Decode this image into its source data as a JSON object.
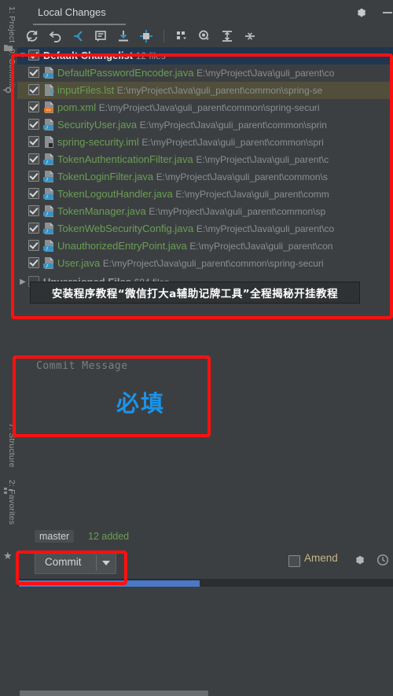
{
  "window": {
    "title": "Local Changes",
    "gear_icon": "gear-icon",
    "minimize_icon": "minimize-icon"
  },
  "rail": {
    "items": [
      {
        "label": "1: Project",
        "icon": "project-folder-icon"
      },
      {
        "label": "0: Commit",
        "icon": "commit-icon"
      },
      {
        "label": "7: Structure",
        "icon": "structure-icon"
      },
      {
        "label": "2: Favorites",
        "icon": "star-icon"
      }
    ]
  },
  "toolbar": {
    "items": [
      {
        "name": "refresh-icon",
        "title": "Refresh"
      },
      {
        "name": "rollback-icon",
        "title": "Rollback"
      },
      {
        "name": "shelve-icon",
        "title": "Shelve Silently"
      },
      {
        "name": "diff-icon",
        "title": "Show Diff"
      },
      {
        "name": "update-icon",
        "title": "Update"
      },
      {
        "name": "move-to-changelist-icon",
        "title": "Move to Another Changelist"
      },
      {
        "name": "group-by-icon",
        "title": "Group By"
      },
      {
        "name": "preview-diff-icon",
        "title": "Preview Diff"
      },
      {
        "name": "expand-all-icon",
        "title": "Expand All"
      },
      {
        "name": "collapse-all-icon",
        "title": "Collapse All"
      }
    ]
  },
  "tree": {
    "changelist": {
      "name": "Default Changelist",
      "count": "12 files",
      "checked": true,
      "expanded": true,
      "arrow": "chevron-down-icon"
    },
    "files": [
      {
        "name": "DefaultPasswordEncoder.java",
        "path": "E:\\myProject\\Java\\guli_parent\\co",
        "icon": "java-file-icon",
        "checked": true,
        "selected": false
      },
      {
        "name": "inputFiles.lst",
        "path": "E:\\myProject\\Java\\guli_parent\\common\\spring-se",
        "icon": "unknown-file-icon",
        "checked": true,
        "selected": true
      },
      {
        "name": "pom.xml",
        "path": "E:\\myProject\\Java\\guli_parent\\common\\spring-securi",
        "icon": "xml-file-icon",
        "checked": true,
        "selected": false
      },
      {
        "name": "SecurityUser.java",
        "path": "E:\\myProject\\Java\\guli_parent\\common\\sprin",
        "icon": "java-file-icon",
        "checked": true,
        "selected": false
      },
      {
        "name": "spring-security.iml",
        "path": "E:\\myProject\\Java\\guli_parent\\common\\spri",
        "icon": "iml-file-icon",
        "checked": true,
        "selected": false
      },
      {
        "name": "TokenAuthenticationFilter.java",
        "path": "E:\\myProject\\Java\\guli_parent\\c",
        "icon": "java-file-icon",
        "checked": true,
        "selected": false
      },
      {
        "name": "TokenLoginFilter.java",
        "path": "E:\\myProject\\Java\\guli_parent\\common\\s",
        "icon": "java-file-icon",
        "checked": true,
        "selected": false
      },
      {
        "name": "TokenLogoutHandler.java",
        "path": "E:\\myProject\\Java\\guli_parent\\comm",
        "icon": "java-file-icon",
        "checked": true,
        "selected": false
      },
      {
        "name": "TokenManager.java",
        "path": "E:\\myProject\\Java\\guli_parent\\common\\sp",
        "icon": "java-file-icon",
        "checked": true,
        "selected": false
      },
      {
        "name": "TokenWebSecurityConfig.java",
        "path": "E:\\myProject\\Java\\guli_parent\\co",
        "icon": "java-file-icon",
        "checked": true,
        "selected": false
      },
      {
        "name": "UnauthorizedEntryPoint.java",
        "path": "E:\\myProject\\Java\\guli_parent\\con",
        "icon": "java-file-icon",
        "checked": true,
        "selected": false
      },
      {
        "name": "User.java",
        "path": "E:\\myProject\\Java\\guli_parent\\common\\spring-securi",
        "icon": "java-file-icon",
        "checked": true,
        "selected": false
      }
    ],
    "unversioned": {
      "name": "Unversioned Files",
      "count": "684 files",
      "checked": false,
      "expanded": false,
      "arrow": "chevron-right-icon"
    }
  },
  "commit_message": {
    "placeholder": "Commit Message",
    "annotation": "必填"
  },
  "bottom": {
    "branch": "master",
    "added": "12 added",
    "commit_label": "Commit",
    "commit_caret_icon": "chevron-down-icon",
    "amend_label": "Amend",
    "amend_checked": false,
    "settings_icon": "gear-icon",
    "history_icon": "clock-icon"
  },
  "banner": {
    "text": "安装程序教程“微信打大a辅助记牌工具”全程揭秘开挂教程"
  },
  "colors": {
    "background": "#3c3f41",
    "changelist_selected": "#20354f",
    "row_selected": "#514f3b",
    "file_green": "#6a9e54",
    "path_gray": "#8b8f91",
    "accent_blue": "#1d93e8",
    "annotation_red": "#ff1010",
    "progress_blue": "#4a78c8"
  }
}
